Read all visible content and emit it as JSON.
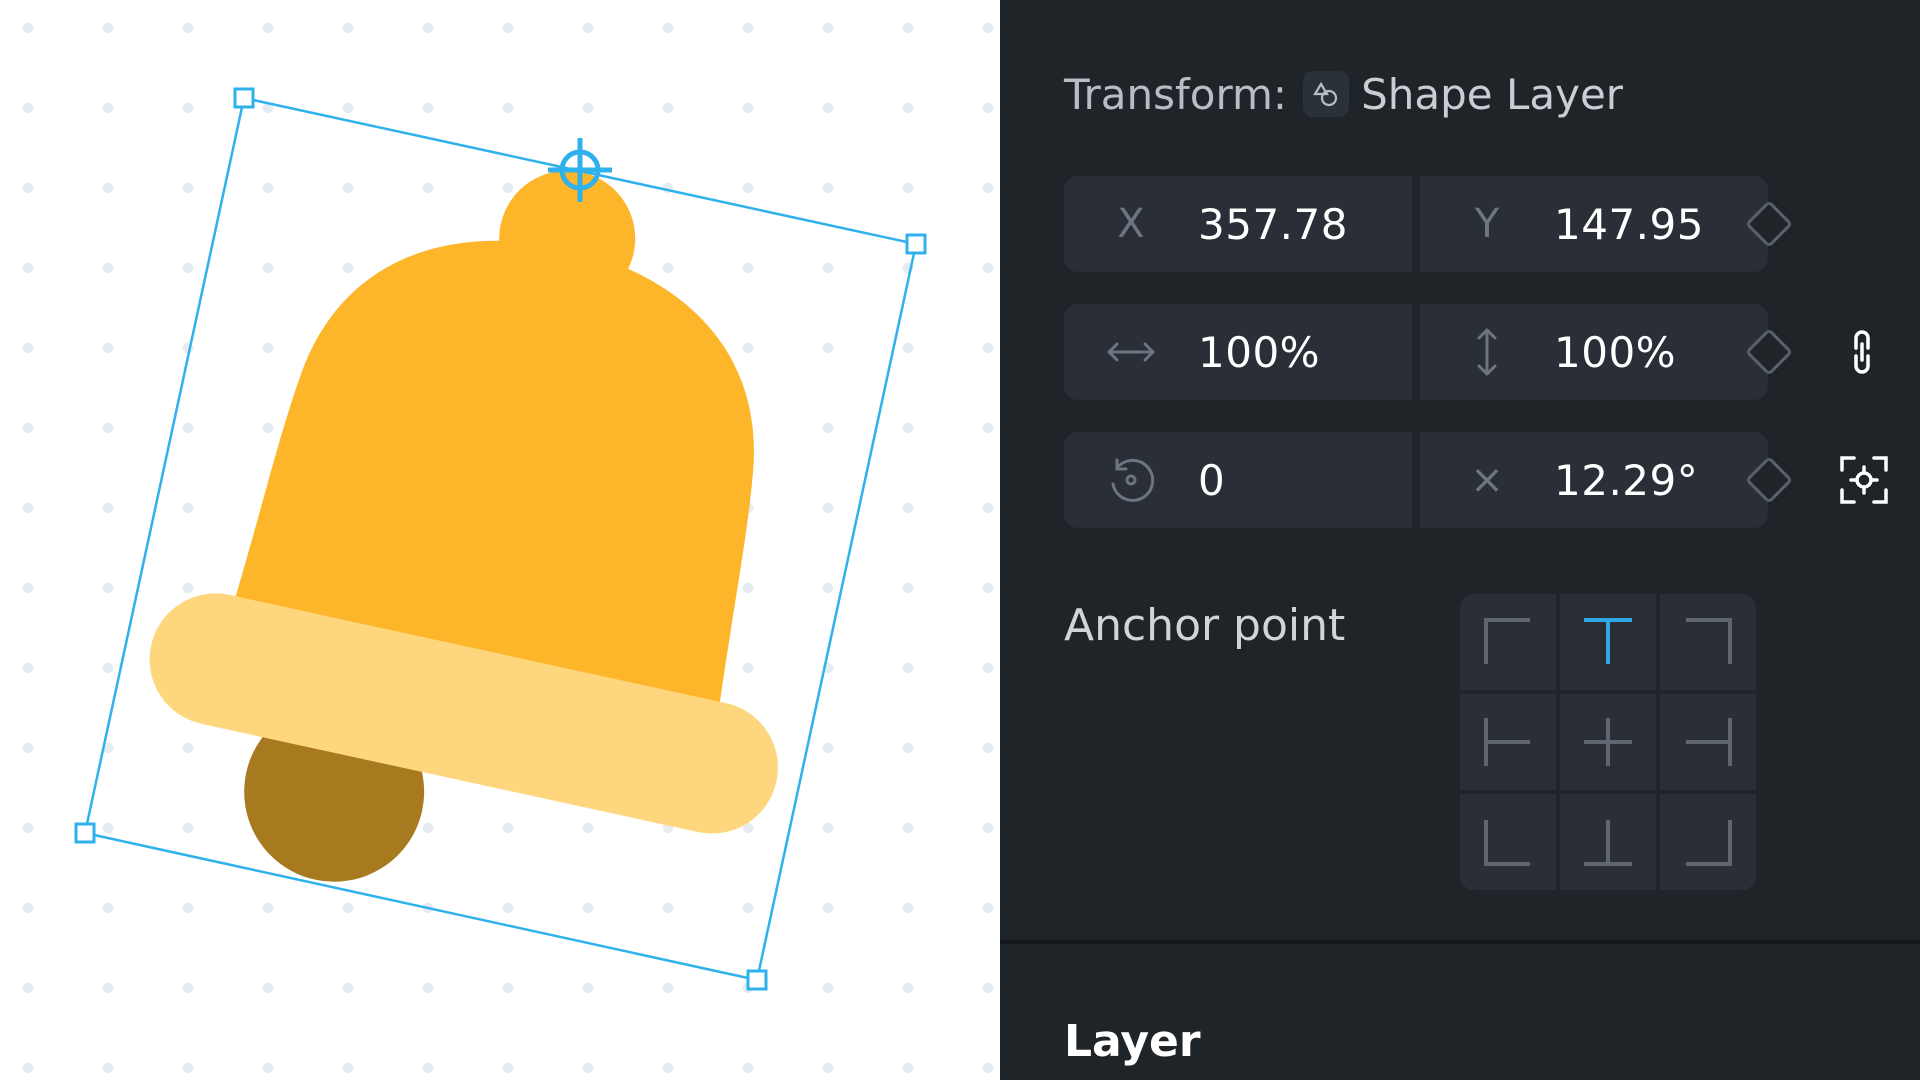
{
  "canvas": {
    "bell_body_color": "#fdb52a",
    "bell_rim_color": "#fed67d",
    "bell_clapper_color": "#a87a1f",
    "selection_color": "#2fb1ec"
  },
  "panel": {
    "title_label": "Transform:",
    "layer_type_icon": "shape-layer-icon",
    "layer_name": "Shape Layer",
    "position": {
      "x_label": "X",
      "x_value": "357.78",
      "y_label": "Y",
      "y_value": "147.95"
    },
    "scale": {
      "width_icon": "horizontal-arrows-icon",
      "width_value": "100%",
      "height_icon": "vertical-arrows-icon",
      "height_value": "100%",
      "lock_icon": "link-icon"
    },
    "rotation": {
      "turns_icon": "rotate-icon",
      "turns_value": "0",
      "multiplier_label": "×",
      "angle_value": "12.29°",
      "focus_icon": "focus-anchor-icon"
    },
    "anchor_point_label": "Anchor point",
    "anchor_selected": "top-center",
    "accent_color": "#2fa8e6",
    "layer_section_title": "Layer"
  }
}
